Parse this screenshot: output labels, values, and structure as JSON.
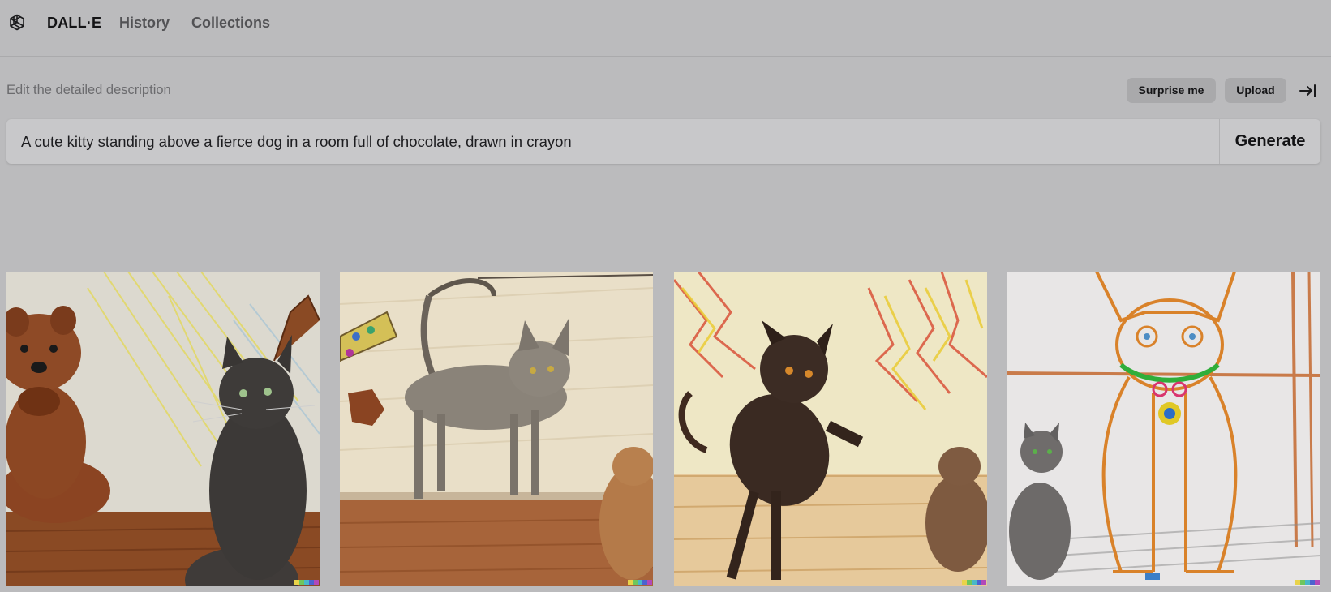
{
  "nav": {
    "brand": "DALL·E",
    "history": "History",
    "collections": "Collections"
  },
  "editor": {
    "label": "Edit the detailed description",
    "surprise_label": "Surprise me",
    "upload_label": "Upload",
    "prompt_value": "A cute kitty standing above a fierce dog in a room full of chocolate, drawn in crayon",
    "generate_label": "Generate"
  },
  "results": [
    {
      "signature_colors": [
        "#e9d34a",
        "#6fc65c",
        "#49b7c8",
        "#4c63cf",
        "#b149b9"
      ]
    },
    {
      "signature_colors": [
        "#e9d34a",
        "#6fc65c",
        "#49b7c8",
        "#4c63cf",
        "#b149b9"
      ]
    },
    {
      "signature_colors": [
        "#e9d34a",
        "#6fc65c",
        "#49b7c8",
        "#4c63cf",
        "#b149b9"
      ]
    },
    {
      "signature_colors": [
        "#e9d34a",
        "#6fc65c",
        "#49b7c8",
        "#4c63cf",
        "#b149b9"
      ]
    }
  ],
  "colors": {
    "background": "#bbbbbd",
    "button_bg": "#a9a9ab",
    "prompt_bg": "#c8c8ca"
  }
}
